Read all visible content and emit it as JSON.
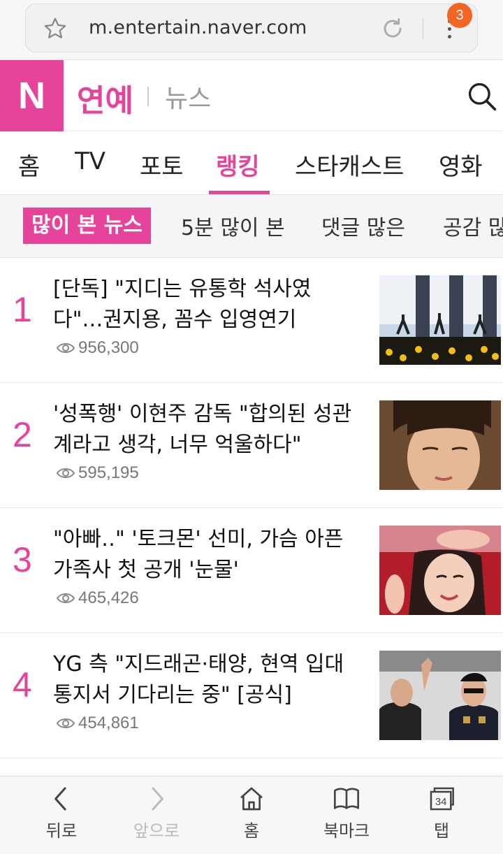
{
  "browser": {
    "url": "m.entertain.naver.com",
    "notification_count": "3",
    "icons": [
      "star-icon",
      "reload-icon",
      "menu-icon"
    ]
  },
  "header": {
    "logo": "N",
    "title": "연예",
    "subtitle": "뉴스",
    "brand_color": "#e5449a"
  },
  "main_tabs": [
    {
      "label": "홈"
    },
    {
      "label": "TV"
    },
    {
      "label": "포토"
    },
    {
      "label": "랭킹",
      "active": true
    },
    {
      "label": "스타캐스트"
    },
    {
      "label": "영화"
    }
  ],
  "sub_tabs": [
    {
      "label": "많이 본 뉴스",
      "active": true
    },
    {
      "label": "5분 많이 본"
    },
    {
      "label": "댓글 많은"
    },
    {
      "label": "공감 많은"
    }
  ],
  "news": [
    {
      "rank": "1",
      "title": "[단독] \"지디는 유통학 석사였다\"…권지용, 꼼수 입영연기",
      "views": "956,300"
    },
    {
      "rank": "2",
      "title": "'성폭행' 이현주 감독 \"합의된 성관계라고 생각, 너무 억울하다\"",
      "views": "595,195"
    },
    {
      "rank": "3",
      "title": "\"아빠‥\" '토크몬' 선미, 가슴 아픈 가족사 첫 공개 '눈물'",
      "views": "465,426"
    },
    {
      "rank": "4",
      "title": "YG 측 \"지드래곤·태양, 현역 입대 통지서 기다리는 중\" [공식]",
      "views": "454,861"
    }
  ],
  "bottom_nav": {
    "back": "뒤로",
    "forward": "앞으로",
    "home": "홈",
    "bookmarks": "북마크",
    "tabs": "탭",
    "tab_count": "34"
  }
}
